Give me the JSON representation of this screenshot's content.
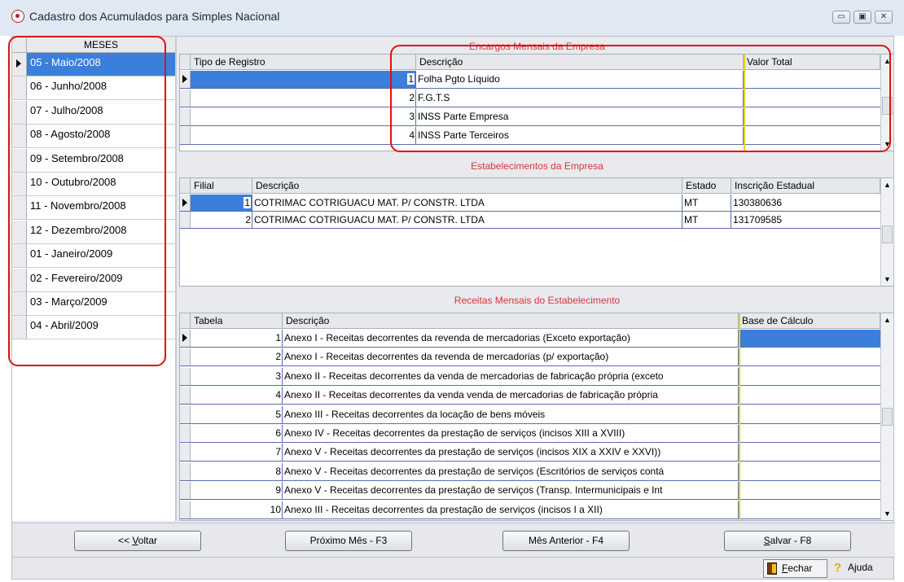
{
  "window": {
    "title": "Cadastro dos Acumulados para Simples Nacional",
    "btn_min": "▭",
    "btn_max": "▣",
    "btn_close": "✕"
  },
  "months": {
    "header": "MESES",
    "items": [
      "05 - Maio/2008",
      "06 - Junho/2008",
      "07 - Julho/2008",
      "08 - Agosto/2008",
      "09 - Setembro/2008",
      "10 - Outubro/2008",
      "11 - Novembro/2008",
      "12 - Dezembro/2008",
      "01 - Janeiro/2009",
      "02 - Fevereiro/2009",
      "03 - Março/2009",
      "04 - Abril/2009"
    ],
    "selected_index": 0
  },
  "encargos": {
    "title": "Encargos Mensais da Empresa",
    "columns": [
      "Tipo de Registro",
      "Descrição",
      "Valor Total"
    ],
    "rows": [
      {
        "num": "1",
        "desc": "Folha Pgto Líquido",
        "valor": ""
      },
      {
        "num": "2",
        "desc": "F.G.T.S",
        "valor": ""
      },
      {
        "num": "3",
        "desc": "INSS Parte Empresa",
        "valor": ""
      },
      {
        "num": "4",
        "desc": "INSS Parte Terceiros",
        "valor": ""
      }
    ]
  },
  "estabelecimentos": {
    "title": "Estabelecimentos da Empresa",
    "columns": [
      "Filial",
      "Descrição",
      "Estado",
      "Inscrição Estadual"
    ],
    "rows": [
      {
        "filial": "1",
        "desc": "COTRIMAC COTRIGUACU MAT. P/ CONSTR. LTDA",
        "estado": "MT",
        "ie": "130380636"
      },
      {
        "filial": "2",
        "desc": "COTRIMAC COTRIGUACU MAT. P/ CONSTR. LTDA",
        "estado": "MT",
        "ie": "131709585"
      }
    ]
  },
  "receitas": {
    "title": "Receitas Mensais do Estabelecimento",
    "columns": [
      "Tabela",
      "Descrição",
      "Base de Cálculo"
    ],
    "rows": [
      {
        "num": "1",
        "desc": "Anexo I - Receitas decorrentes da revenda de mercadorias (Exceto exportação)"
      },
      {
        "num": "2",
        "desc": "Anexo I - Receitas decorrentes da revenda de mercadorias (p/ exportação)"
      },
      {
        "num": "3",
        "desc": "Anexo II - Receitas decorrentes da venda de mercadorias de fabricação própria (exceto"
      },
      {
        "num": "4",
        "desc": "Anexo II - Receitas decorrentes da venda venda de mercadorias de fabricação própria"
      },
      {
        "num": "5",
        "desc": "Anexo III - Receitas decorrentes da locação de bens móveis"
      },
      {
        "num": "6",
        "desc": "Anexo IV - Receitas decorrentes da prestação de serviços (incisos XIII a XVIII)"
      },
      {
        "num": "7",
        "desc": "Anexo V - Receitas decorrentes da prestação de serviços (incisos XIX a XXIV e XXVI))"
      },
      {
        "num": "8",
        "desc": "Anexo V - Receitas decorrentes da prestação de serviços (Escritórios de serviços contá"
      },
      {
        "num": "9",
        "desc": "Anexo V - Receitas decorrentes da prestação de serviços (Transp. Intermunicipais e Int"
      },
      {
        "num": "10",
        "desc": "Anexo III - Receitas decorrentes da prestação de serviços (incisos I a XII)"
      }
    ]
  },
  "buttons": {
    "voltar_pre": "<< ",
    "voltar_u": "V",
    "voltar_post": "oltar",
    "proximo": "Próximo Mês  - F3",
    "anterior": "Mês Anterior - F4",
    "salvar_u": "S",
    "salvar_post": "alvar - F8"
  },
  "status": {
    "fechar_u": "F",
    "fechar_post": "echar",
    "ajuda": "Ajuda"
  },
  "colors": {
    "selection": "#3a7fdc",
    "section_title": "#d9353a",
    "annotation": "#e01010"
  }
}
